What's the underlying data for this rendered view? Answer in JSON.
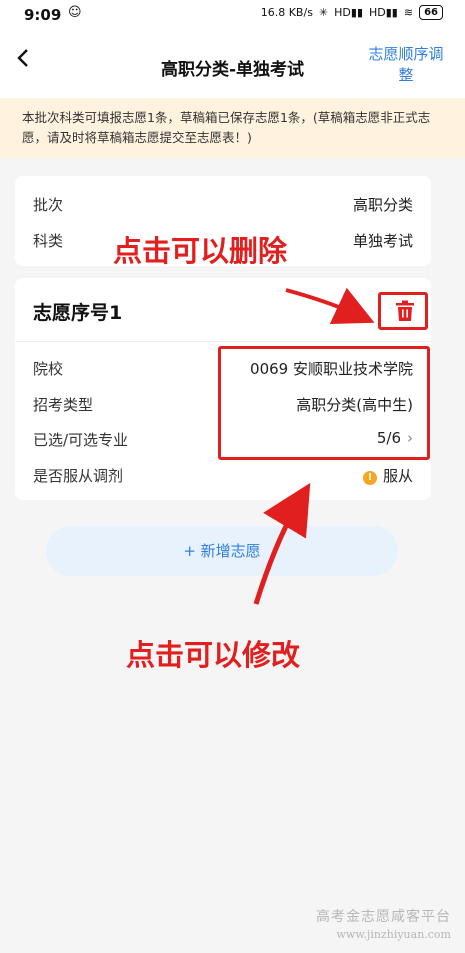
{
  "status_bar": {
    "time": "9:09",
    "net_speed": "16.8 KB/s",
    "signal_1": "HD",
    "signal_2": "HD",
    "battery": "66"
  },
  "nav": {
    "back_icon": "chevron-left-icon",
    "title": "高职分类-单独考试",
    "right_line1": "志愿顺序调",
    "right_line2": "整"
  },
  "notice": "本批次科类可填报志愿1条，草稿箱已保存志愿1条，(草稿箱志愿非正式志愿，请及时将草稿箱志愿提交至志愿表！)",
  "info": {
    "batch_label": "批次",
    "batch_value": "高职分类",
    "category_label": "科类",
    "category_value": "单独考试"
  },
  "wish": {
    "title": "志愿序号1",
    "delete_icon": "trash-icon",
    "school_label": "院校",
    "school_value": "0069 安顺职业技术学院",
    "exam_type_label": "招考类型",
    "exam_type_value": "高职分类(高中生)",
    "majors_label": "已选/可选专业",
    "majors_value": "5/6",
    "adjust_label": "是否服从调剂",
    "adjust_value": "服从"
  },
  "add_button": "+ 新增志愿",
  "annotations": {
    "delete": "点击可以删除",
    "edit": "点击可以修改"
  },
  "colors": {
    "accent": "#2f7fe0",
    "annotation_red": "#e21f1f",
    "notice_bg": "#fff3e0",
    "adjust_dot": "#f5a623"
  },
  "watermark": {
    "line1": "高考金志愿咸客平台",
    "line2": "www.jinzhiyuan.com"
  }
}
